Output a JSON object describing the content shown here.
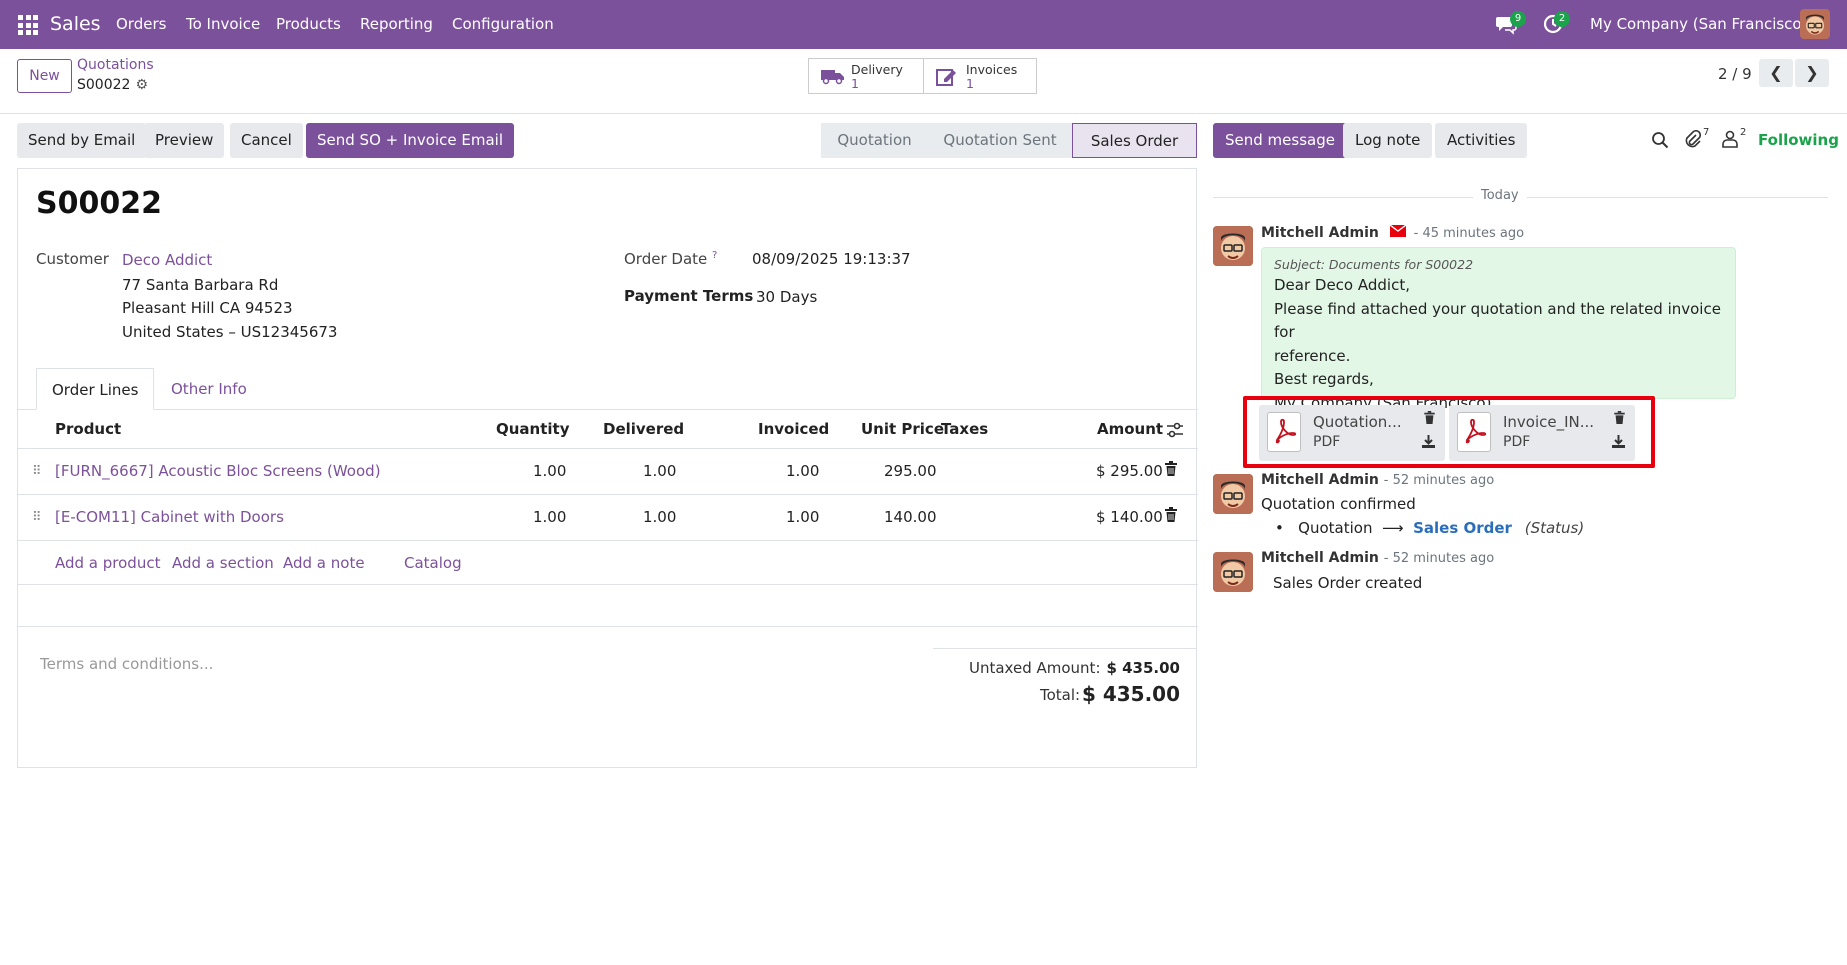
{
  "nav": {
    "brand": "Sales",
    "menu": [
      "Orders",
      "To Invoice",
      "Products",
      "Reporting",
      "Configuration"
    ],
    "messages_badge": "9",
    "activities_badge": "2",
    "company": "My Company (San Francisco)"
  },
  "control": {
    "new_label": "New",
    "breadcrumb_parent": "Quotations",
    "breadcrumb_current": "S00022",
    "smart_delivery_label": "Delivery",
    "smart_delivery_value": "1",
    "smart_invoices_label": "Invoices",
    "smart_invoices_value": "1",
    "pager": "2 / 9"
  },
  "actions": {
    "send_email": "Send by Email",
    "preview": "Preview",
    "cancel": "Cancel",
    "send_so_invoice": "Send SO + Invoice Email"
  },
  "statusbar": [
    "Quotation",
    "Quotation Sent",
    "Sales Order"
  ],
  "form": {
    "name": "S00022",
    "customer_label": "Customer",
    "customer_name": "Deco Addict",
    "address_1": "77 Santa Barbara Rd",
    "address_2": "Pleasant Hill CA 94523",
    "address_3": "United States – US12345673",
    "order_date_label": "Order Date",
    "order_date_help": "?",
    "order_date": "08/09/2025 19:13:37",
    "payment_terms_label": "Payment Terms",
    "payment_terms": "30 Days",
    "tab_order_lines": "Order Lines",
    "tab_other_info": "Other Info",
    "columns": [
      "Product",
      "Quantity",
      "Delivered",
      "Invoiced",
      "Unit Price",
      "Taxes",
      "Amount"
    ],
    "lines": [
      {
        "product": "[FURN_6667] Acoustic Bloc Screens (Wood)",
        "qty": "1.00",
        "delivered": "1.00",
        "invoiced": "1.00",
        "price": "295.00",
        "amount": "$ 295.00"
      },
      {
        "product": "[E-COM11] Cabinet with Doors",
        "qty": "1.00",
        "delivered": "1.00",
        "invoiced": "1.00",
        "price": "140.00",
        "amount": "$ 140.00"
      }
    ],
    "add_product": "Add a product",
    "add_section": "Add a section",
    "add_note": "Add a note",
    "catalog": "Catalog",
    "terms_placeholder": "Terms and conditions...",
    "untaxed_label": "Untaxed Amount:",
    "untaxed_value": "$ 435.00",
    "total_label": "Total:",
    "total_value": "$ 435.00"
  },
  "chatter": {
    "send_message": "Send message",
    "log_note": "Log note",
    "activities": "Activities",
    "attachments_count": "7",
    "followers_count": "2",
    "following": "Following",
    "today": "Today",
    "messages": [
      {
        "author": "Mitchell Admin",
        "ago": "- 45 minutes ago",
        "subject": "Subject: Documents for S00022",
        "body": [
          "Dear Deco Addict,",
          "Please find attached your quotation and the related invoice for",
          "reference.",
          "Best regards,",
          "My Company (San Francisco)"
        ],
        "attachments": [
          {
            "name": "Quotation...",
            "type": "PDF"
          },
          {
            "name": "Invoice_IN...",
            "type": "PDF"
          }
        ]
      },
      {
        "author": "Mitchell Admin",
        "ago": "- 52 minutes ago",
        "text": "Quotation confirmed",
        "change_from": "Quotation",
        "change_to": "Sales Order",
        "change_field": "(Status)"
      },
      {
        "author": "Mitchell Admin",
        "ago": "- 52 minutes ago",
        "text": "Sales Order created"
      }
    ]
  },
  "colors": {
    "brand": "#7c519b",
    "highlight": "#e8000e",
    "following": "#1aa34a",
    "note_bg": "#e3f7e7"
  }
}
